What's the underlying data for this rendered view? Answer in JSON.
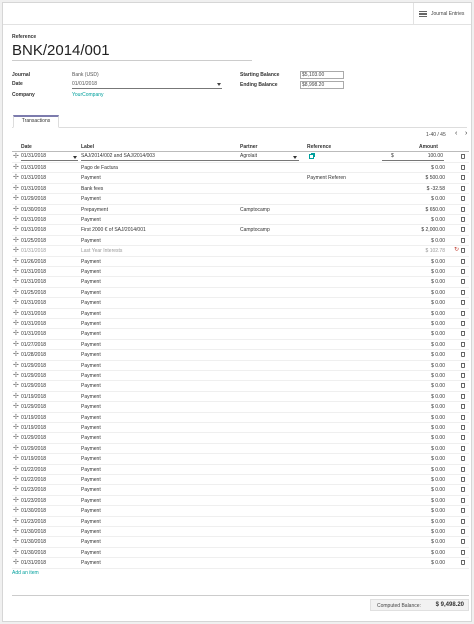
{
  "header": {
    "smart_button_label": "Journal Entries",
    "smart_button_icon": "menu-list-icon"
  },
  "form": {
    "reference_label": "Reference",
    "reference_value": "BNK/2014/001",
    "journal_label": "Journal",
    "journal_value": "Bank (USD)",
    "date_label": "Date",
    "date_value": "01/01/2018",
    "company_label": "Company",
    "company_value": "YourCompany",
    "starting_balance_label": "Starting Balance",
    "starting_balance_value": "$5,103.00",
    "ending_balance_label": "Ending Balance",
    "ending_balance_value": "$8,998.20"
  },
  "tabs": [
    {
      "label": "Transactions"
    }
  ],
  "pager": {
    "text": "1-40 / 45",
    "prev": "‹",
    "next": "›"
  },
  "table": {
    "columns": {
      "date": "Date",
      "label": "Label",
      "partner": "Partner",
      "reference": "Reference",
      "amount": "Amount"
    },
    "editing_row": {
      "date": "01/31/2018",
      "label": "SAJ/2014/002 and SAJ/2014/003",
      "partner": "Agrolait",
      "currency": "$",
      "amount": "100.00"
    },
    "rows": [
      {
        "date": "01/31/2018",
        "label": "Pago de Factura",
        "partner": "",
        "reference": "",
        "amount": "$ 0.00"
      },
      {
        "date": "01/31/2018",
        "label": "Payment",
        "partner": "",
        "reference": "Payment Referen",
        "amount": "$ 500.00"
      },
      {
        "date": "01/31/2018",
        "label": "Bank fees",
        "partner": "",
        "reference": "",
        "amount": "$ -32.58"
      },
      {
        "date": "01/29/2018",
        "label": "Payment",
        "partner": "",
        "reference": "",
        "amount": "$ 0.00"
      },
      {
        "date": "01/30/2018",
        "label": "Prepayment",
        "partner": "Camptocamp",
        "reference": "",
        "amount": "$ 650.00"
      },
      {
        "date": "01/31/2018",
        "label": "Payment",
        "partner": "",
        "reference": "",
        "amount": "$ 0.00"
      },
      {
        "date": "01/31/2018",
        "label": "First 2000 € of SAJ/2014/001",
        "partner": "Camptocamp",
        "reference": "",
        "amount": "$ 2,000.00"
      },
      {
        "date": "01/25/2018",
        "label": "Payment",
        "partner": "",
        "reference": "",
        "amount": "$ 0.00"
      },
      {
        "date": "01/31/2018",
        "label": "Last Year Interests",
        "partner": "",
        "reference": "",
        "amount": "$ 102.78",
        "muted": true
      },
      {
        "date": "01/26/2018",
        "label": "Payment",
        "partner": "",
        "reference": "",
        "amount": "$ 0.00"
      },
      {
        "date": "01/31/2018",
        "label": "Payment",
        "partner": "",
        "reference": "",
        "amount": "$ 0.00"
      },
      {
        "date": "01/31/2018",
        "label": "Payment",
        "partner": "",
        "reference": "",
        "amount": "$ 0.00"
      },
      {
        "date": "01/25/2018",
        "label": "Payment",
        "partner": "",
        "reference": "",
        "amount": "$ 0.00"
      },
      {
        "date": "01/31/2018",
        "label": "Payment",
        "partner": "",
        "reference": "",
        "amount": "$ 0.00"
      },
      {
        "date": "01/31/2018",
        "label": "Payment",
        "partner": "",
        "reference": "",
        "amount": "$ 0.00"
      },
      {
        "date": "01/31/2018",
        "label": "Payment",
        "partner": "",
        "reference": "",
        "amount": "$ 0.00"
      },
      {
        "date": "01/31/2018",
        "label": "Payment",
        "partner": "",
        "reference": "",
        "amount": "$ 0.00"
      },
      {
        "date": "01/27/2018",
        "label": "Payment",
        "partner": "",
        "reference": "",
        "amount": "$ 0.00"
      },
      {
        "date": "01/28/2018",
        "label": "Payment",
        "partner": "",
        "reference": "",
        "amount": "$ 0.00"
      },
      {
        "date": "01/29/2018",
        "label": "Payment",
        "partner": "",
        "reference": "",
        "amount": "$ 0.00"
      },
      {
        "date": "01/29/2018",
        "label": "Payment",
        "partner": "",
        "reference": "",
        "amount": "$ 0.00"
      },
      {
        "date": "01/29/2018",
        "label": "Payment",
        "partner": "",
        "reference": "",
        "amount": "$ 0.00"
      },
      {
        "date": "01/19/2018",
        "label": "Payment",
        "partner": "",
        "reference": "",
        "amount": "$ 0.00"
      },
      {
        "date": "01/29/2018",
        "label": "Payment",
        "partner": "",
        "reference": "",
        "amount": "$ 0.00"
      },
      {
        "date": "01/19/2018",
        "label": "Payment",
        "partner": "",
        "reference": "",
        "amount": "$ 0.00"
      },
      {
        "date": "01/19/2018",
        "label": "Payment",
        "partner": "",
        "reference": "",
        "amount": "$ 0.00"
      },
      {
        "date": "01/29/2018",
        "label": "Payment",
        "partner": "",
        "reference": "",
        "amount": "$ 0.00"
      },
      {
        "date": "01/29/2018",
        "label": "Payment",
        "partner": "",
        "reference": "",
        "amount": "$ 0.00"
      },
      {
        "date": "01/19/2018",
        "label": "Payment",
        "partner": "",
        "reference": "",
        "amount": "$ 0.00"
      },
      {
        "date": "01/22/2018",
        "label": "Payment",
        "partner": "",
        "reference": "",
        "amount": "$ 0.00"
      },
      {
        "date": "01/22/2018",
        "label": "Payment",
        "partner": "",
        "reference": "",
        "amount": "$ 0.00"
      },
      {
        "date": "01/23/2018",
        "label": "Payment",
        "partner": "",
        "reference": "",
        "amount": "$ 0.00"
      },
      {
        "date": "01/23/2018",
        "label": "Payment",
        "partner": "",
        "reference": "",
        "amount": "$ 0.00"
      },
      {
        "date": "01/30/2018",
        "label": "Payment",
        "partner": "",
        "reference": "",
        "amount": "$ 0.00"
      },
      {
        "date": "01/23/2018",
        "label": "Payment",
        "partner": "",
        "reference": "",
        "amount": "$ 0.00"
      },
      {
        "date": "01/30/2018",
        "label": "Payment",
        "partner": "",
        "reference": "",
        "amount": "$ 0.00"
      },
      {
        "date": "01/30/2018",
        "label": "Payment",
        "partner": "",
        "reference": "",
        "amount": "$ 0.00"
      },
      {
        "date": "01/30/2018",
        "label": "Payment",
        "partner": "",
        "reference": "",
        "amount": "$ 0.00"
      },
      {
        "date": "01/31/2018",
        "label": "Payment",
        "partner": "",
        "reference": "",
        "amount": "$ 0.00"
      }
    ],
    "add_item_label": "Add an item"
  },
  "footer": {
    "computed_label": "Computed Balance:",
    "computed_value": "$ 9,498.20"
  },
  "colors": {
    "accent": "#00a09d",
    "tab_accent": "#7c7bad"
  }
}
